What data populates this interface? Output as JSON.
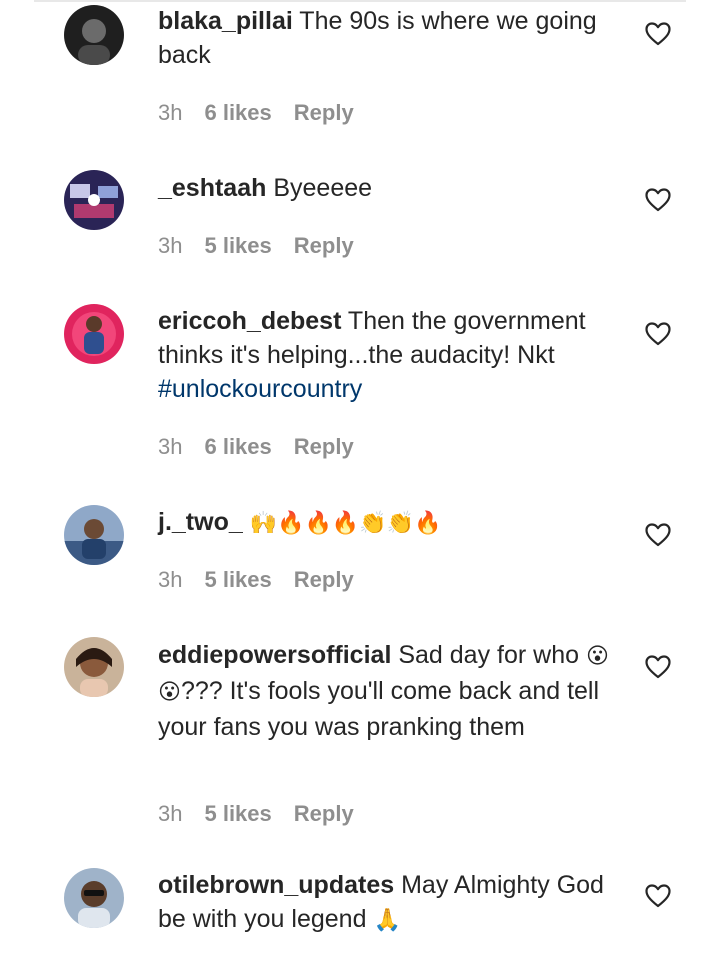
{
  "comments": [
    {
      "username": "blaka_pillai",
      "text": "The 90s is where we going back",
      "hashtag": "",
      "emojis": "",
      "trailing": "",
      "time": "3h",
      "likes": "6 likes",
      "reply": "Reply",
      "avatar_color": "#2b2b2b"
    },
    {
      "username": "_eshtaah",
      "text": "Byeeeee",
      "hashtag": "",
      "emojis": "",
      "trailing": "",
      "time": "3h",
      "likes": "5 likes",
      "reply": "Reply",
      "avatar_color": "#3a2d6b"
    },
    {
      "username": "ericcoh_debest",
      "text": "Then the government thinks it's helping...the audacity! Nkt",
      "hashtag": "#unlockourcountry",
      "emojis": "",
      "trailing": "",
      "time": "3h",
      "likes": "6 likes",
      "reply": "Reply",
      "avatar_color": "#e0245e"
    },
    {
      "username": "j._two_",
      "text": "",
      "hashtag": "",
      "emojis": "🙌🔥🔥🔥👏👏🔥",
      "trailing": "",
      "time": "3h",
      "likes": "5 likes",
      "reply": "Reply",
      "avatar_color": "#4a6fa5"
    },
    {
      "username": "eddiepowersofficial",
      "text": "Sad day for who",
      "hashtag": "",
      "emojis": "😮😮",
      "trailing": "??? It's fools you'll come back and tell your fans you was pranking them",
      "time": "3h",
      "likes": "5 likes",
      "reply": "Reply",
      "avatar_color": "#8a5a3c"
    },
    {
      "username": "otilebrown_updates",
      "text": "May Almighty God be with you legend",
      "hashtag": "",
      "emojis": "🙏",
      "trailing": "",
      "time": "",
      "likes": "",
      "reply": "",
      "avatar_color": "#6b7f99"
    }
  ],
  "icons": {
    "heart": "heart-outline-icon"
  },
  "colors": {
    "text": "#262626",
    "meta": "#8e8e8e",
    "hashtag": "#00376b"
  }
}
